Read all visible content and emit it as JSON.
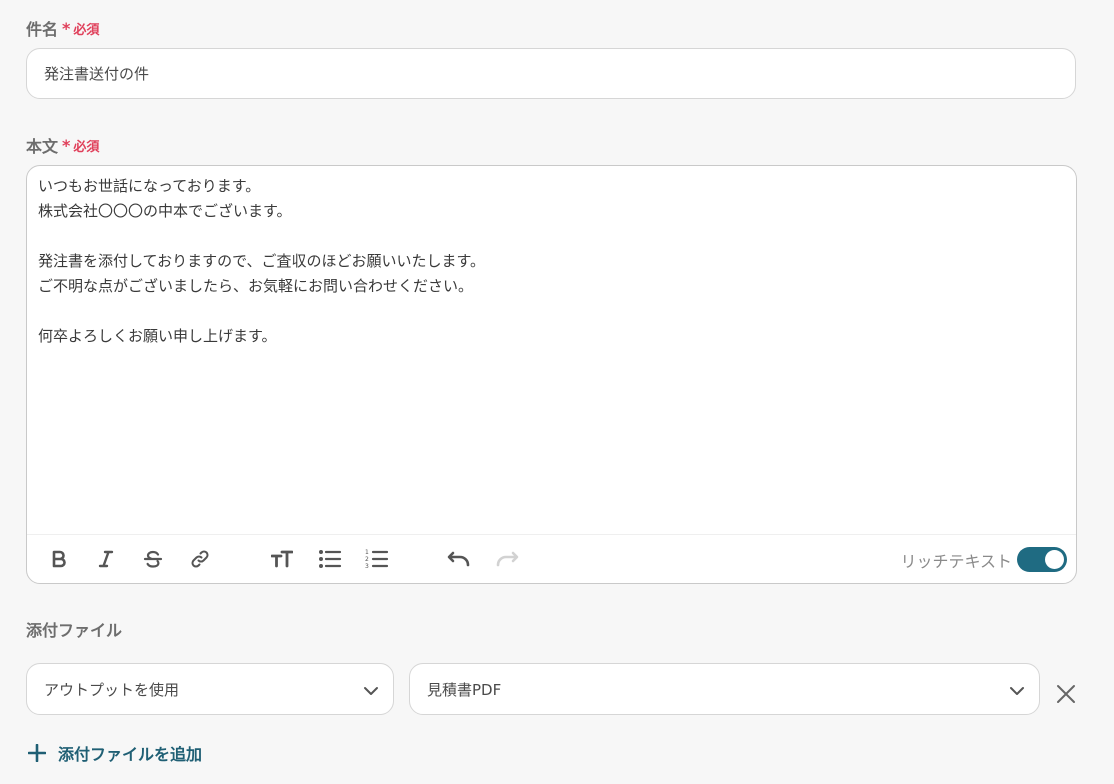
{
  "subject": {
    "label": "件名",
    "required_mark": "*",
    "required_text": "必須",
    "value": "発注書送付の件"
  },
  "body": {
    "label": "本文",
    "required_mark": "*",
    "required_text": "必須",
    "value": "いつもお世話になっております。\n株式会社〇〇〇の中本でございます。\n\n発注書を添付しておりますので、ご査収のほどお願いいたします。\nご不明な点がございましたら、お気軽にお問い合わせください。\n\n何卒よろしくお願い申し上げます。",
    "toolbar": {
      "icons": [
        "bold-icon",
        "italic-icon",
        "strikethrough-icon",
        "link-icon",
        "text-size-icon",
        "bullet-list-icon",
        "numbered-list-icon",
        "undo-icon",
        "redo-icon"
      ],
      "rich_text_label": "リッチテキスト",
      "rich_text_enabled": true
    }
  },
  "attachments": {
    "label": "添付ファイル",
    "rows": [
      {
        "source": "アウトプットを使用",
        "file": "見積書PDF"
      }
    ],
    "add_label": "添付ファイルを追加"
  },
  "colors": {
    "accent": "#1f6b82",
    "required": "#e0405b",
    "link": "#1f5f74"
  }
}
